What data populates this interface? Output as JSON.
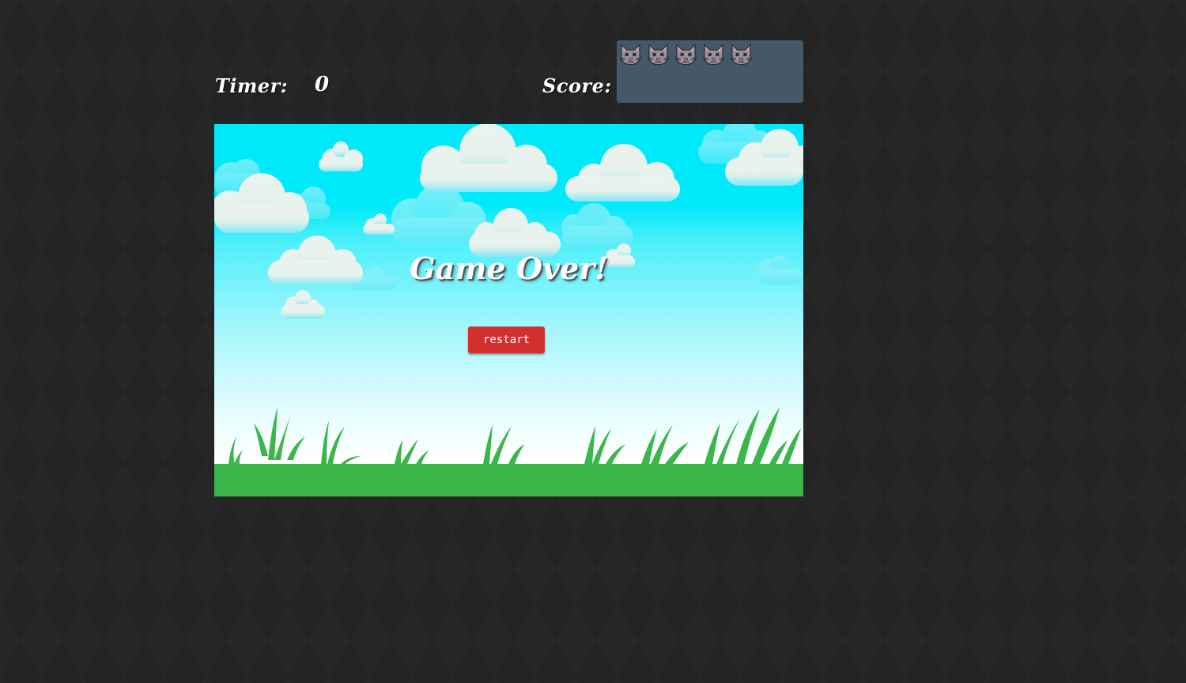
{
  "hud": {
    "timer_label": "Timer:",
    "timer_value": "0",
    "score_label": "Score:",
    "score_icons": [
      "cat-head-icon",
      "cat-head-icon",
      "cat-head-icon",
      "cat-head-icon",
      "cat-head-icon"
    ]
  },
  "game": {
    "title": "Game Over!",
    "restart_label": "restart"
  },
  "colors": {
    "page_background": "#232323",
    "score_box": "#455868",
    "sky_top": "#00e9fa",
    "sky_bottom": "#ffffff",
    "ground": "#39b54a",
    "grass": "#3cb54a",
    "restart_button": "#d32f2f"
  }
}
